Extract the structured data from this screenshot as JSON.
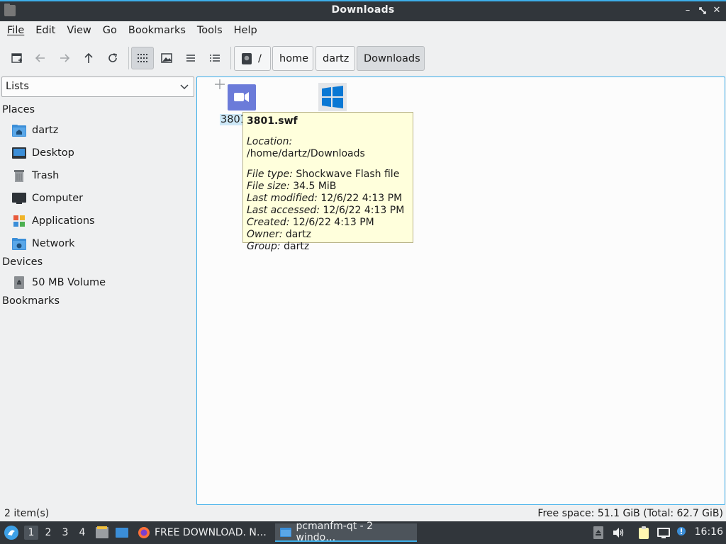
{
  "window": {
    "title": "Downloads"
  },
  "menu": [
    "File",
    "Edit",
    "View",
    "Go",
    "Bookmarks",
    "Tools",
    "Help"
  ],
  "breadcrumb": [
    "/",
    "home",
    "dartz",
    "Downloads"
  ],
  "sidepane": {
    "selector": "Lists",
    "places_label": "Places",
    "places": [
      "dartz",
      "Desktop",
      "Trash",
      "Computer",
      "Applications",
      "Network"
    ],
    "devices_label": "Devices",
    "devices": [
      "50 MB Volume"
    ],
    "bookmarks_label": "Bookmarks"
  },
  "files": [
    {
      "name": "3801",
      "icon": "video-file-icon"
    },
    {
      "name": "",
      "icon": "windows-executable-icon"
    }
  ],
  "tooltip": {
    "title": "3801.swf",
    "location_label": "Location:",
    "location": "/home/dartz/Downloads",
    "type_label": "File type:",
    "type": "Shockwave Flash file",
    "size_label": "File size:",
    "size": "34.5 MiB",
    "modified_label": "Last modified:",
    "modified": "12/6/22 4:13 PM",
    "accessed_label": "Last accessed:",
    "accessed": "12/6/22 4:13 PM",
    "created_label": "Created:",
    "created": "12/6/22 4:13 PM",
    "owner_label": "Owner:",
    "owner": "dartz",
    "group_label": "Group:",
    "group": "dartz"
  },
  "status": {
    "items": "2 item(s)",
    "free_space": "Free space: 51.1 GiB (Total: 62.7 GiB)"
  },
  "taskbar": {
    "desktops": [
      "1",
      "2",
      "3",
      "4"
    ],
    "task_firefox": "FREE DOWNLOAD. N…",
    "task_pcmanfm": "pcmanfm-qt - 2 windo…",
    "clock": "16:16"
  },
  "colors": {
    "accent": "#3daee9",
    "titlebar": "#31363b",
    "tooltip_bg": "#ffffdc",
    "video_icon": "#6b7bd9",
    "windows_icon": "#0a78d4"
  }
}
